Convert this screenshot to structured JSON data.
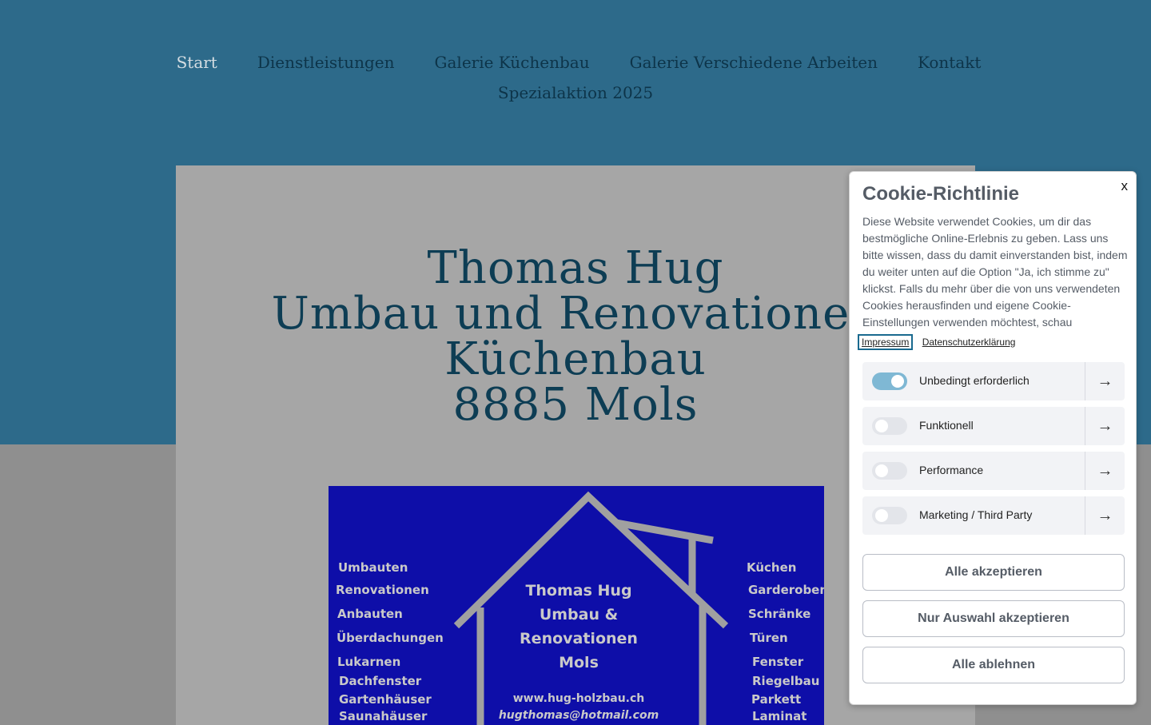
{
  "nav": {
    "items": [
      {
        "label": "Start"
      },
      {
        "label": "Dienstleistungen"
      },
      {
        "label": "Galerie Küchenbau"
      },
      {
        "label": "Galerie Verschiedene Arbeiten"
      },
      {
        "label": "Kontakt"
      },
      {
        "label": "Spezialaktion 2025"
      }
    ]
  },
  "headline": {
    "line1": "Thomas Hug",
    "line2": "Umbau und Renovationen",
    "line3": "Küchenbau",
    "line4": "8885 Mols"
  },
  "card": {
    "left_items": [
      "Umbauten",
      "Renovationen",
      "Anbauten",
      "Überdachungen",
      "Lukarnen",
      "Dachfenster",
      "Gartenhäuser",
      "Saunahäuser"
    ],
    "right_items": [
      "Küchen",
      "Garderoben",
      "Schränke",
      "Türen",
      "Fenster",
      "Riegelbau",
      "Parkett",
      "Laminat"
    ],
    "center_line1": "Thomas Hug",
    "center_line2": "Umbau &",
    "center_line3": "Renovationen",
    "center_line4": "Mols",
    "website": "www.hug-holzbau.ch",
    "email": "hugthomas@hotmail.com"
  },
  "cookie": {
    "close_label": "x",
    "title": "Cookie-Richtlinie",
    "text": "Diese Website verwendet Cookies, um dir das bestmögliche Online-Erlebnis zu geben. Lass uns bitte wissen, dass du damit einverstanden bist, indem du weiter unten auf die Option \"Ja, ich stimme zu\" klickst. Falls du mehr über die von uns verwendeten Cookies herausfinden und eigene Cookie-Einstellungen verwenden möchtest, schau",
    "link_impressum": "Impressum",
    "link_datenschutz": "Datenschutzerklärung",
    "options": [
      {
        "label": "Unbedingt erforderlich",
        "enabled": true
      },
      {
        "label": "Funktionell",
        "enabled": false
      },
      {
        "label": "Performance",
        "enabled": false
      },
      {
        "label": "Marketing / Third Party",
        "enabled": false
      }
    ],
    "btn_accept_all": "Alle akzeptieren",
    "btn_accept_selection": "Nur Auswahl akzeptieren",
    "btn_reject_all": "Alle ablehnen"
  }
}
